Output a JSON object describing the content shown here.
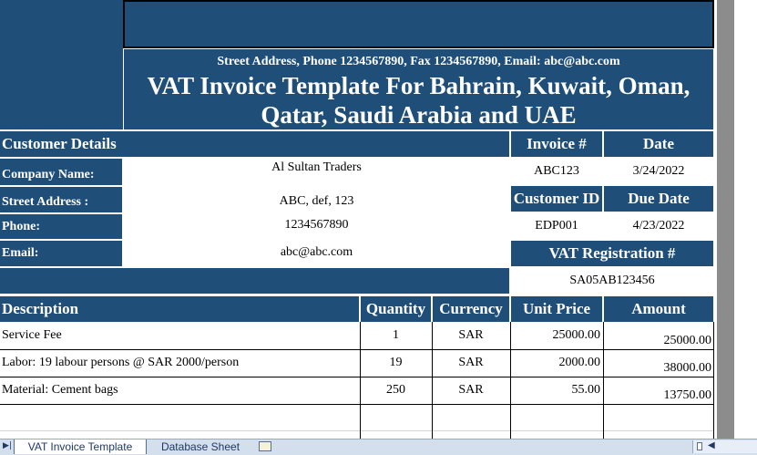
{
  "sheet": {
    "address_line": "Street Address, Phone 1234567890, Fax 1234567890, Email: abc@abc.com",
    "title_line1": "VAT Invoice Template For Bahrain, Kuwait, Oman,",
    "title_line2": "Qatar, Saudi Arabia and UAE"
  },
  "customer": {
    "section_label": "Customer Details",
    "company_label": "Company Name:",
    "company_value": "Al Sultan Traders",
    "street_label": "Street Address :",
    "street_value": "ABC, def, 123",
    "phone_label": "Phone:",
    "phone_value": "1234567890",
    "email_label": "Email:",
    "email_value": "abc@abc.com"
  },
  "invoice": {
    "invoice_no_label": "Invoice #",
    "invoice_no_value": "ABC123",
    "date_label": "Date",
    "date_value": "3/24/2022",
    "customer_id_label": "Customer ID",
    "customer_id_value": "EDP001",
    "due_date_label": "Due Date",
    "due_date_value": "4/23/2022",
    "vat_label": "VAT Registration #",
    "vat_value": "SA05AB123456"
  },
  "items_table": {
    "headers": {
      "description": "Description",
      "quantity": "Quantity",
      "currency": "Currency",
      "unit_price": "Unit Price",
      "amount": "Amount"
    },
    "rows": [
      {
        "description": "Service Fee",
        "quantity": "1",
        "currency": "SAR",
        "unit_price": "25000.00",
        "amount": "25000.00"
      },
      {
        "description": "Labor: 19 labour persons @ SAR 2000/person",
        "quantity": "19",
        "currency": "SAR",
        "unit_price": "2000.00",
        "amount": "38000.00"
      },
      {
        "description": "Material: Cement bags",
        "quantity": "250",
        "currency": "SAR",
        "unit_price": "55.00",
        "amount": "13750.00"
      }
    ]
  },
  "tabs": [
    {
      "label": "VAT Invoice Template"
    },
    {
      "label": "Database Sheet"
    }
  ]
}
